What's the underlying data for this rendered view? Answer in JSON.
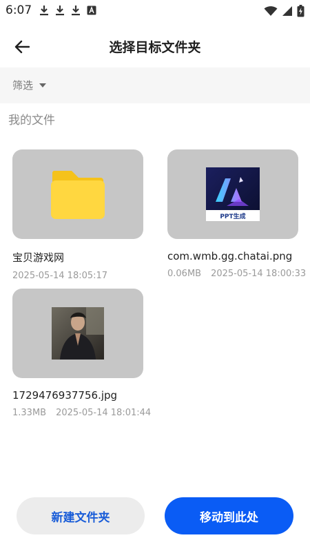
{
  "status_bar": {
    "time": "6:07",
    "left_icons": [
      "download-icon",
      "download-icon",
      "download-icon",
      "app-notification-icon"
    ],
    "right_icons": [
      "wifi-icon",
      "signal-icon",
      "battery-charging-icon"
    ]
  },
  "header": {
    "title": "选择目标文件夹",
    "back_icon": "arrow-left-icon"
  },
  "filter": {
    "label": "筛选",
    "icon": "caret-down-icon"
  },
  "section": {
    "title": "我的文件"
  },
  "files": [
    {
      "name": "宝贝游戏网",
      "size": "",
      "date": "2025-05-14 18:05:17",
      "kind": "folder"
    },
    {
      "name": "com.wmb.gg.chatai.png",
      "size": "0.06MB",
      "date": "2025-05-14 18:00:33",
      "kind": "image",
      "thumb_text": "PPT生成"
    },
    {
      "name": "1729476937756.jpg",
      "size": "1.33MB",
      "date": "2025-05-14 18:01:44",
      "kind": "photo"
    }
  ],
  "actions": {
    "new_folder": "新建文件夹",
    "move_here": "移动到此处"
  },
  "colors": {
    "primary": "#0a5cf5",
    "secondary_text": "#1a5dd8",
    "folder": "#ffd740",
    "thumb_bg": "#c6c6c6"
  }
}
